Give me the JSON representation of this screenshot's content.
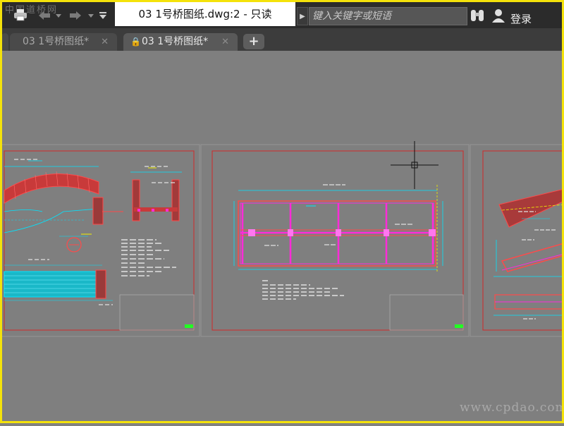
{
  "window": {
    "title": "03 1号桥图纸.dwg:2 - 只读",
    "qat_watermark": "中国道桥网",
    "search_placeholder": "键入关键字或短语",
    "login_label": "登录"
  },
  "tabs": [
    {
      "label": "03 1号桥图纸*",
      "active": false
    },
    {
      "label": "03 1号桥图纸*",
      "active": true
    }
  ],
  "new_tab_label": "+",
  "icons": {
    "print": "print-icon",
    "undo": "undo-icon",
    "redo": "redo-icon",
    "qat_menu": "dropdown-icon",
    "search_arrow": "play-arrow-icon",
    "binoculars": "binoculars-icon",
    "user": "user-icon",
    "lock": "lock-icon",
    "close": "close-icon"
  },
  "colors": {
    "frame_border": "#f4e20a",
    "canvas": "#7f7f7f",
    "drawing_red": "#d02828",
    "drawing_cyan": "#00e5ff",
    "drawing_magenta": "#ff2bd8",
    "drawing_yellow": "#f0f000",
    "drawing_green": "#22ff22"
  },
  "footer_watermark": "www.cpdao.com"
}
